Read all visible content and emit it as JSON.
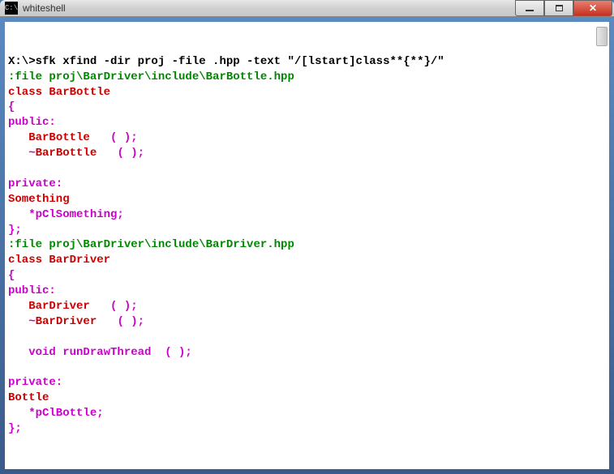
{
  "window": {
    "title": "whiteshell",
    "icon_label": "C:\\"
  },
  "prompt": {
    "prefix": "X:\\>",
    "command": "sfk xfind -dir proj -file .hpp -text \"/[lstart]class**{**}/\""
  },
  "results": [
    {
      "header": ":file proj\\BarDriver\\include\\BarBottle.hpp",
      "lines": [
        {
          "type": "red",
          "text": "class BarBottle"
        },
        {
          "type": "magenta",
          "text": "{"
        },
        {
          "type": "magenta",
          "text": "public:"
        },
        {
          "type": "mixed",
          "pre": "   ",
          "red": "BarBottle",
          "post": "   ( );"
        },
        {
          "type": "mixed",
          "pre": "   ~",
          "red": "BarBottle",
          "post": "   ( );"
        },
        {
          "type": "blank",
          "text": ""
        },
        {
          "type": "magenta",
          "text": "private:"
        },
        {
          "type": "red",
          "text": "Something"
        },
        {
          "type": "magenta",
          "text": "   *pClSomething;"
        },
        {
          "type": "magenta",
          "text": "};"
        }
      ]
    },
    {
      "header": ":file proj\\BarDriver\\include\\BarDriver.hpp",
      "lines": [
        {
          "type": "red",
          "text": "class BarDriver"
        },
        {
          "type": "magenta",
          "text": "{"
        },
        {
          "type": "magenta",
          "text": "public:"
        },
        {
          "type": "mixed",
          "pre": "   ",
          "red": "BarDriver",
          "post": "   ( );"
        },
        {
          "type": "mixed",
          "pre": "   ~",
          "red": "BarDriver",
          "post": "   ( );"
        },
        {
          "type": "blank",
          "text": ""
        },
        {
          "type": "magenta",
          "text": "   void runDrawThread  ( );"
        },
        {
          "type": "blank",
          "text": ""
        },
        {
          "type": "magenta",
          "text": "private:"
        },
        {
          "type": "red",
          "text": "Bottle"
        },
        {
          "type": "magenta",
          "text": "   *pClBottle;"
        },
        {
          "type": "magenta",
          "text": "};"
        }
      ]
    }
  ]
}
